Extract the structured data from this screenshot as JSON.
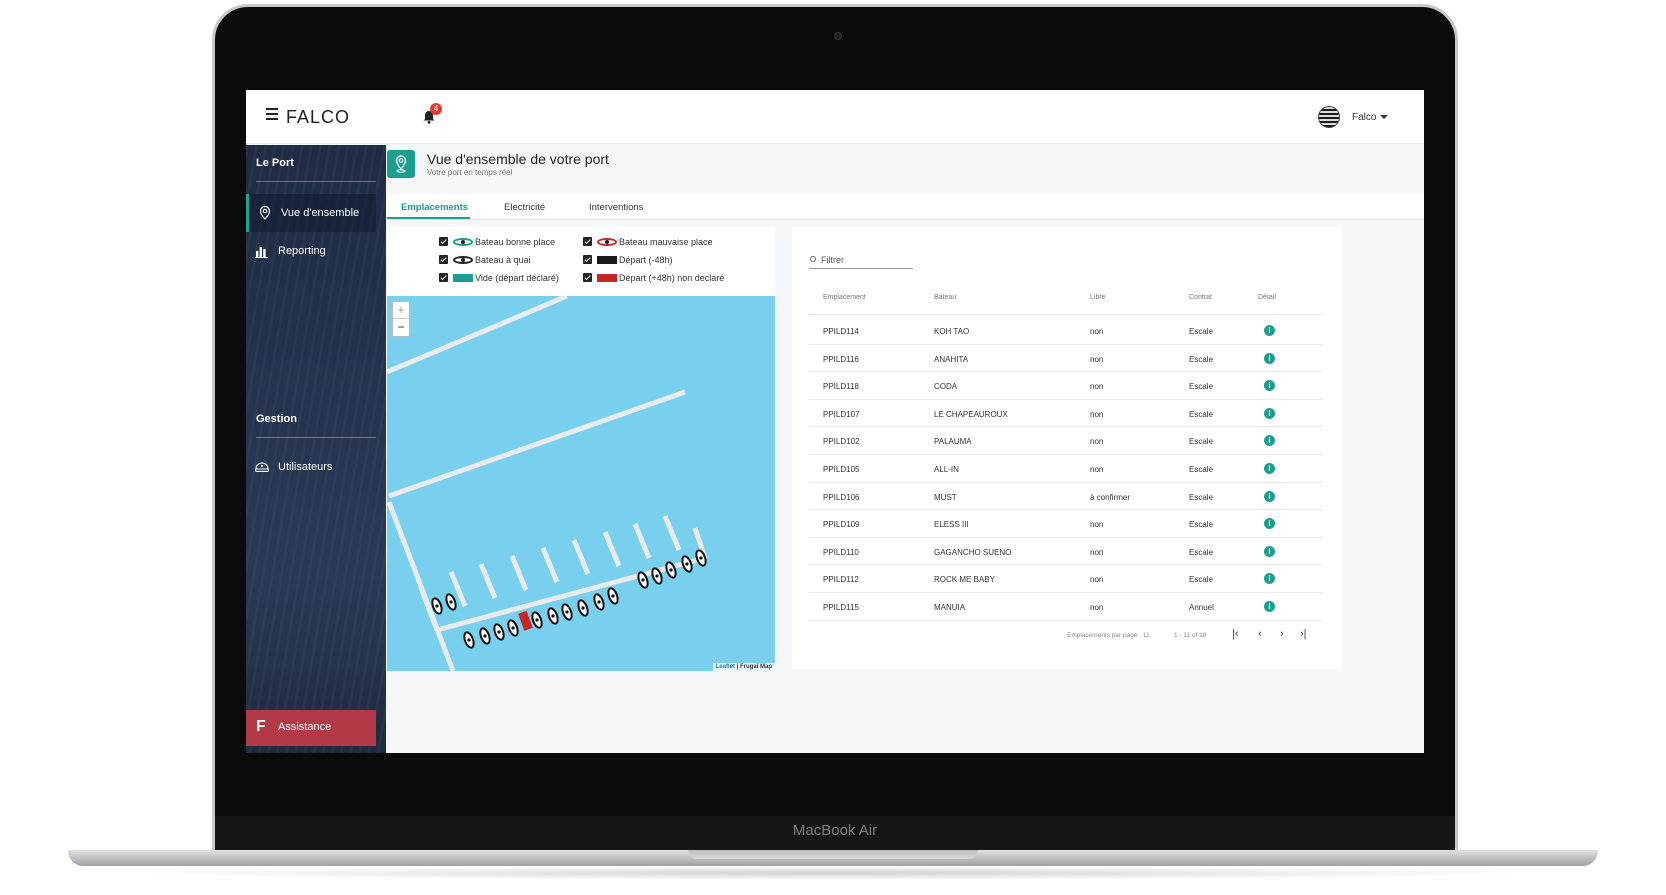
{
  "device": {
    "brand": "MacBook Air"
  },
  "topbar": {
    "logo": "FALCO",
    "notifications": "4",
    "user": "Falco"
  },
  "sidebar": {
    "section1": "Le Port",
    "items": [
      {
        "label": "Vue d'ensemble",
        "icon": "map-pin-icon",
        "active": true
      },
      {
        "label": "Reporting",
        "icon": "bar-chart-icon",
        "active": false
      }
    ],
    "section2": "Gestion",
    "items2": [
      {
        "label": "Utilisateurs",
        "icon": "captain-hat-icon"
      }
    ],
    "assistance": {
      "letter": "F",
      "label": "Assistance"
    }
  },
  "page": {
    "title": "Vue d'ensemble de votre port",
    "subtitle": "Votre port en temps réel",
    "tabs": [
      "Emplacements",
      "Electricité",
      "Interventions"
    ]
  },
  "legend": [
    {
      "label": "Bateau bonne place",
      "kind": "boat",
      "color": "#1a9e8f"
    },
    {
      "label": "Bateau mauvaise place",
      "kind": "boat",
      "color": "#c62828"
    },
    {
      "label": "Bateau à quai",
      "kind": "boat",
      "color": "#222222"
    },
    {
      "label": "Départ (-48h)",
      "kind": "swatch",
      "color": "#1a1a1a"
    },
    {
      "label": "Vide (départ déclaré)",
      "kind": "swatch",
      "color": "#1a9e8f"
    },
    {
      "label": "Départ (+48h) non declaré",
      "kind": "swatch",
      "color": "#c62828"
    }
  ],
  "map": {
    "attribution_link": "Leaflet",
    "attribution_rest": " | Frugal Map",
    "zoom_in": "+",
    "zoom_out": "−"
  },
  "table": {
    "filter_placeholder": "Filtrer",
    "columns": [
      "Emplacement",
      "Bateau",
      "Libre",
      "Contrat",
      "Détail"
    ],
    "rows": [
      [
        "PPILD114",
        "KOH TAO",
        "non",
        "Escale"
      ],
      [
        "PPILD116",
        "ANAHITA",
        "non",
        "Escale"
      ],
      [
        "PPILD118",
        "CODA",
        "non",
        "Escale"
      ],
      [
        "PPILD107",
        "LE CHAPEAUROUX",
        "non",
        "Escale"
      ],
      [
        "PPILD102",
        "PALAUMA",
        "non",
        "Escale"
      ],
      [
        "PPILD105",
        "ALL-IN",
        "non",
        "Escale"
      ],
      [
        "PPILD106",
        "MUST",
        "à confirmer",
        "Escale"
      ],
      [
        "PPILD109",
        "ELESS III",
        "non",
        "Escale"
      ],
      [
        "PPILD110",
        "GAGANCHO SUENO",
        "non",
        "Escale"
      ],
      [
        "PPILD112",
        "ROCK ME BABY",
        "non",
        "Escale"
      ],
      [
        "PPILD115",
        "MANUIA",
        "non",
        "Annuel"
      ]
    ],
    "detail_icon": "i",
    "pager": {
      "per_page_label": "Emplacements par page : 11",
      "range": "1 - 11 of 18",
      "first": "|‹",
      "prev": "‹",
      "next": "›",
      "last": "›|"
    }
  }
}
